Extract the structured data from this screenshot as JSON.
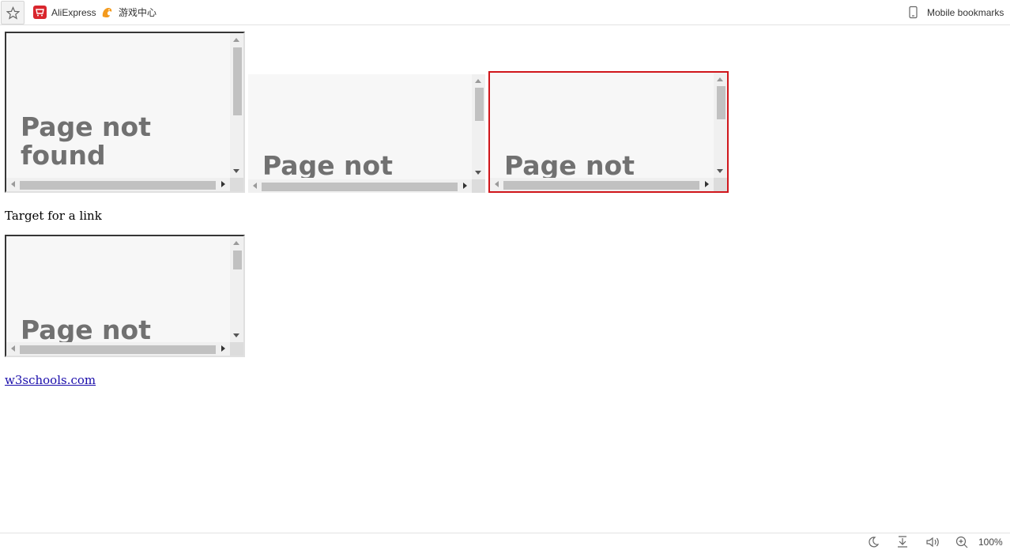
{
  "bookmarks_bar": {
    "items": [
      {
        "label": "AliExpress",
        "icon": "aliexpress-icon"
      },
      {
        "label": "游戏中心",
        "icon": "game-center-icon"
      }
    ],
    "mobile_bookmarks": {
      "label": "Mobile bookmarks",
      "icon": "mobile-icon"
    }
  },
  "frames": [
    {
      "text": "Page not found"
    },
    {
      "text": "Page not"
    },
    {
      "text": "Page not"
    },
    {
      "text": "Page not"
    }
  ],
  "target_text": "Target for a link",
  "link": {
    "label": "w3schools.com"
  },
  "status_bar": {
    "icons": [
      "night-mode-icon",
      "download-icon",
      "sound-icon",
      "zoom-icon"
    ],
    "zoom": "100%"
  },
  "colors": {
    "highlight_border": "#d0161b",
    "link": "#1a0dab",
    "frame_text": "#717171"
  }
}
